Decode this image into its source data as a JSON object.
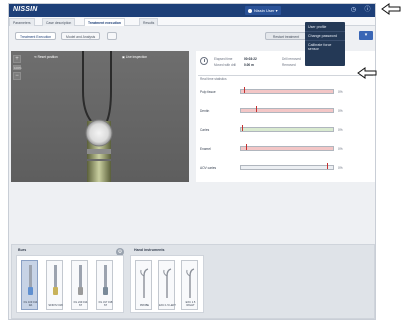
{
  "header": {
    "logo": "NISSIN",
    "user_label": "Nissin User",
    "icons": [
      "user-icon",
      "clock-icon",
      "info-icon"
    ]
  },
  "tabs": [
    {
      "label": "Parameters",
      "active": false
    },
    {
      "label": "Case description",
      "active": false
    },
    {
      "label": "Treatment execution",
      "active": true
    },
    {
      "label": "Results",
      "active": false
    }
  ],
  "subnav": {
    "treatment_execution": "Treatment Execution",
    "model_analysis": "Model and Analysis",
    "restart_label": "Restart treatment"
  },
  "user_menu": {
    "items": [
      "User profile",
      "Change password",
      "Calibrate force sensor"
    ]
  },
  "simulation": {
    "reset_position": "Reset position",
    "live_inspection": "Live inspection",
    "zoom_in": "+",
    "zoom_out": "−",
    "zoom_level": "100%"
  },
  "stats": {
    "elapsed_label": "Elapsed time",
    "elapsed_value": "00:03:22",
    "moved_label": "Moved with drill",
    "moved_value": "0.00 m",
    "drill_label": "Drill removed",
    "removed_label": "Removed",
    "realtime_title": "Real time statistics",
    "rows": [
      {
        "name": "Pulp tissue",
        "percent": "0%",
        "marker": 0.03,
        "color": "#f3c6c6"
      },
      {
        "name": "Dentin",
        "percent": "0%",
        "marker": 0.16,
        "color": "#f3c6c6"
      },
      {
        "name": "Caries",
        "percent": "0%",
        "marker": 0.01,
        "color": "#d9ead0"
      },
      {
        "name": "Enamel",
        "percent": "0%",
        "marker": 0.05,
        "color": "#f3c6c6"
      },
      {
        "name": "AOV caries",
        "percent": "0%",
        "marker": 0.94,
        "color": "#eceff3"
      }
    ]
  },
  "burs": {
    "title": "Burs",
    "items": [
      {
        "label": "FG 109 014 RA",
        "selected": true,
        "tip_color": "#5f8fd0"
      },
      {
        "label": "SF6072 018",
        "selected": false,
        "tip_color": "#c8b25a"
      },
      {
        "label": "FG 249 014 ST",
        "selected": false,
        "tip_color": "#9b9b9b"
      },
      {
        "label": "FG 317 018 ST",
        "selected": false,
        "tip_color": "#7a8a99"
      }
    ]
  },
  "instruments": {
    "title": "Hand instruments",
    "items": [
      {
        "label": "PROBE"
      },
      {
        "label": "EXC 1.5 LEFT"
      },
      {
        "label": "EXC 1.5 RIGHT"
      }
    ]
  }
}
